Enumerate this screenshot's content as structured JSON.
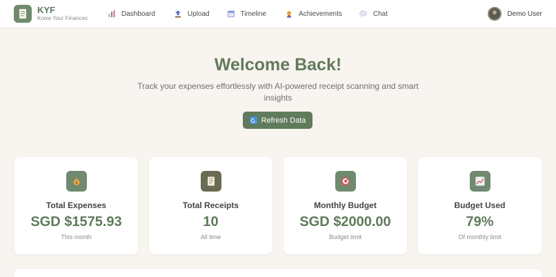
{
  "brand": {
    "name": "KYF",
    "tagline": "Know Your Finances"
  },
  "nav": [
    {
      "label": "Dashboard",
      "icon": "bar-chart-icon"
    },
    {
      "label": "Upload",
      "icon": "upload-icon"
    },
    {
      "label": "Timeline",
      "icon": "calendar-icon"
    },
    {
      "label": "Achievements",
      "icon": "trophy-icon"
    },
    {
      "label": "Chat",
      "icon": "chat-bubble-icon"
    }
  ],
  "user": {
    "name": "Demo User"
  },
  "hero": {
    "title": "Welcome Back!",
    "subtitle": "Track your expenses effortlessly with AI-powered receipt scanning and smart insights",
    "refresh_label": "Refresh Data"
  },
  "cards": [
    {
      "label": "Total Expenses",
      "value": "SGD $1575.93",
      "sub": "This month",
      "icon": "money-bag-icon",
      "icon_bg": "#6f8a6e"
    },
    {
      "label": "Total Receipts",
      "value": "10",
      "sub": "All time",
      "icon": "receipt-icon",
      "icon_bg": "#6b6a52"
    },
    {
      "label": "Monthly Budget",
      "value": "SGD $2000.00",
      "sub": "Budget limit",
      "icon": "target-icon",
      "icon_bg": "#6f8a6e"
    },
    {
      "label": "Budget Used",
      "value": "79%",
      "sub": "Of monthly limit",
      "icon": "trend-chart-icon",
      "icon_bg": "#6f8a6e"
    }
  ],
  "colors": {
    "accent": "#5f7b5b",
    "background": "#f8f4ef"
  }
}
